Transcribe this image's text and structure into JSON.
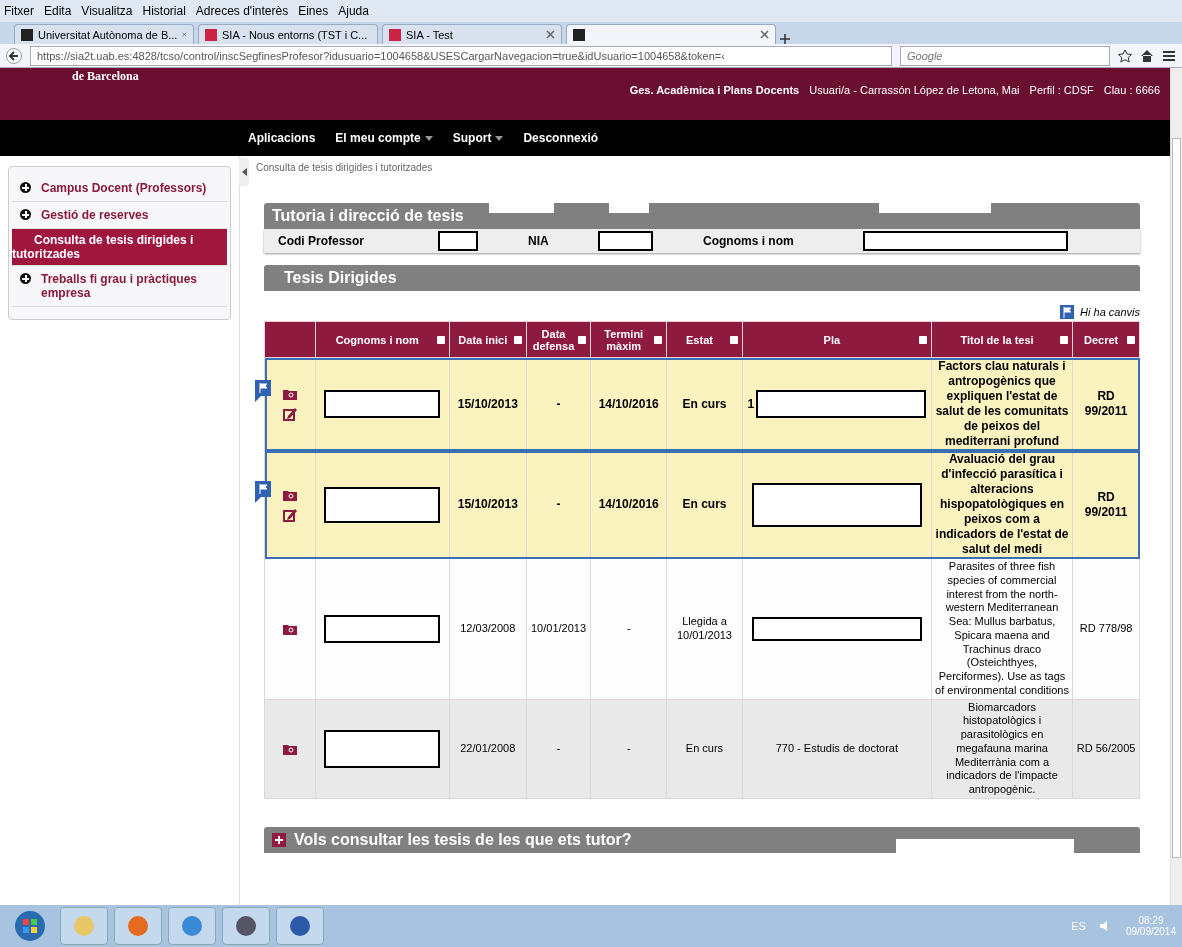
{
  "browser": {
    "menu": [
      "Fitxer",
      "Edita",
      "Visualitza",
      "Historial",
      "Adreces d'interès",
      "Eines",
      "Ajuda"
    ],
    "tabs": [
      {
        "label": "Universitat Autònoma de B...",
        "selected": false
      },
      {
        "label": "SIA - Nous entorns (TST i C...",
        "selected": false
      },
      {
        "label": "SIA - Test",
        "selected": false
      },
      {
        "selected": true
      }
    ],
    "url": "https://sia2t.uab.es:4828/tcso/control/inscSegfinesProfesor?idusuario=1004658&USESCargarNavegacion=true&idUsuario=1004658&token=‹",
    "search_placeholder": "Google"
  },
  "header": {
    "logo_text": "de Barcelona",
    "area": "Ges. Acadèmica i Plans Docents",
    "user": "Usuari/a - Carrassón López de Letona, Mai",
    "profile": "Perfil : CDSF",
    "key": "Clau : 6666"
  },
  "nav": [
    {
      "label": "Aplicacions",
      "dropdown": false
    },
    {
      "label": "El meu compte",
      "dropdown": true
    },
    {
      "label": "Suport",
      "dropdown": true
    },
    {
      "label": "Desconnexió",
      "dropdown": false
    }
  ],
  "sidebar": {
    "items": [
      {
        "label": "Campus Docent (Professors)",
        "selected": false
      },
      {
        "label": "Gestió de reserves",
        "selected": false
      },
      {
        "label": "Consulta de tesis dirigides i tutoritzades",
        "selected": true
      },
      {
        "label": "Treballs fi grau i pràctiques empresa",
        "selected": false
      }
    ]
  },
  "breadcrumb": "Consulta de tesis dirigides i tutoritzades",
  "tutoria": {
    "title": "Tutoria i direcció de tesis",
    "fields": [
      "Codi Professor",
      "NIA",
      "Cognoms i nom"
    ]
  },
  "tesis": {
    "title": "Tesis Dirigides",
    "legend": "Hi ha canvis",
    "columns": [
      "Cognoms i nom",
      "Data inici",
      "Data defensa",
      "Termini màxim",
      "Estat",
      "Pla",
      "Titol de la tesi",
      "Decret"
    ],
    "rows": [
      {
        "changed": true,
        "editable": true,
        "data_inici": "15/10/2013",
        "data_defensa": "-",
        "termini": "14/10/2016",
        "estat": "En curs",
        "pla": "1",
        "pla_redacted": true,
        "titol": "Factors clau naturals i antropogènics que expliquen l'estat de salut de les comunitats de peixos del mediterrani profund",
        "decret": "RD 99/2011"
      },
      {
        "changed": true,
        "editable": true,
        "data_inici": "15/10/2013",
        "data_defensa": "-",
        "termini": "14/10/2016",
        "estat": "En curs",
        "pla": "",
        "pla_redacted": true,
        "titol": "Avaluació del grau d'infecció parasítica i alteracions hispopatològiques en peixos com a indicadors de l'estat de salut del medi",
        "decret": "RD 99/2011"
      },
      {
        "changed": false,
        "editable": false,
        "data_inici": "12/03/2008",
        "data_defensa": "10/01/2013",
        "termini": "-",
        "estat": "Llegida a 10/01/2013",
        "pla": "",
        "pla_redacted": true,
        "titol": "Parasites of three fish species of commercial interest from the north-western Mediterranean Sea: Mullus barbatus, Spicara maena and Trachinus draco (Osteichthyes, Perciformes). Use as tags of environmental conditions",
        "decret": "RD 778/98"
      },
      {
        "changed": false,
        "editable": false,
        "data_inici": "22/01/2008",
        "data_defensa": "-",
        "termini": "-",
        "estat": "En curs",
        "pla": "770 - Estudis de doctorat",
        "pla_redacted": false,
        "titol": "Biomarcadors histopatològics i parasitològics en megafauna marina Mediterrània com a indicadors de l'impacte antropogènic.",
        "decret": "RD 56/2005"
      }
    ]
  },
  "tutor_section": {
    "title": "Vols consultar les tesis de les que ets tutor?",
    "expanded": false
  },
  "taskbar": {
    "language": "ES",
    "time": "08:29",
    "date": "09/09/2014"
  }
}
